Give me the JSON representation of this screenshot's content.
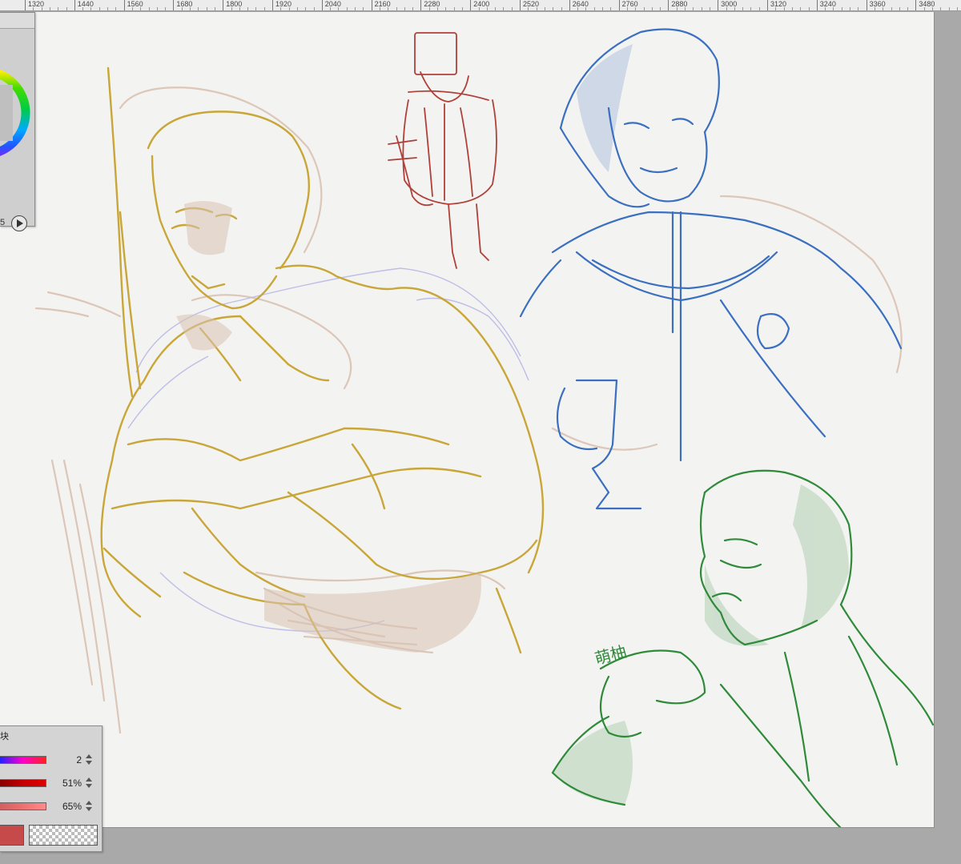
{
  "ruler": {
    "labels": [
      "1320",
      "1440",
      "1560",
      "1680",
      "1800",
      "1920",
      "2040",
      "2160",
      "2280",
      "2400",
      "2520",
      "2640",
      "2760",
      "2880",
      "3000",
      "3120",
      "3240",
      "3360",
      "3480"
    ]
  },
  "canvas": {
    "signature": "萌柚"
  },
  "color_wheel_panel": {
    "value_fragment": "5",
    "play_icon": "play-circle-icon"
  },
  "color_sliders_panel": {
    "title_fragment": "块",
    "sliders": [
      {
        "value": "2",
        "gradient": [
          "#2222ff",
          "#ff00cc",
          "#ff2222"
        ]
      },
      {
        "value": "51%",
        "gradient": [
          "#8a0000",
          "#c40000",
          "#e00000"
        ]
      },
      {
        "value": "65%",
        "gradient": [
          "#d06060",
          "#ee7070",
          "#ff8a8a"
        ]
      }
    ],
    "current_color": "#c64a4a"
  },
  "sketch_colors": {
    "yellow": "#c9a638",
    "beige": "#d9c2b2",
    "red": "#b0413a",
    "blue": "#3b6fc0",
    "green": "#2f8a3a",
    "lavender": "#b9b8e6"
  }
}
